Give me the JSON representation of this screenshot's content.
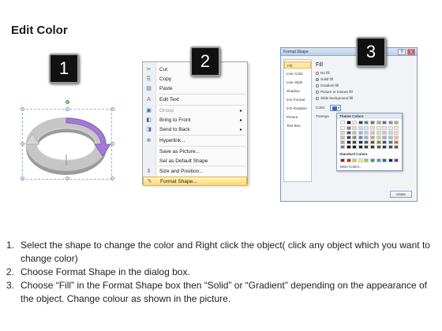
{
  "page": {
    "title": "Edit Color"
  },
  "badges": [
    "1",
    "2",
    "3"
  ],
  "context_menu": {
    "items": [
      {
        "label": "Cut",
        "icon": "scissors-icon",
        "glyph": "✂",
        "disabled": false,
        "submenu": false,
        "highlighted": false
      },
      {
        "label": "Copy",
        "icon": "copy-icon",
        "glyph": "⎘",
        "disabled": false,
        "submenu": false,
        "highlighted": false
      },
      {
        "label": "Paste",
        "icon": "paste-icon",
        "glyph": "▤",
        "disabled": false,
        "submenu": false,
        "highlighted": false
      },
      {
        "label": "Edit Text",
        "icon": "edit-text-icon",
        "glyph": "A",
        "disabled": false,
        "submenu": false,
        "highlighted": false
      },
      {
        "label": "Group",
        "icon": "group-icon",
        "glyph": "▣",
        "disabled": true,
        "submenu": true,
        "highlighted": false
      },
      {
        "label": "Bring to Front",
        "icon": "bring-front-icon",
        "glyph": "◧",
        "disabled": false,
        "submenu": true,
        "highlighted": false
      },
      {
        "label": "Send to Back",
        "icon": "send-back-icon",
        "glyph": "◨",
        "disabled": false,
        "submenu": true,
        "highlighted": false
      },
      {
        "label": "Hyperlink...",
        "icon": "hyperlink-icon",
        "glyph": "⊕",
        "disabled": false,
        "submenu": false,
        "highlighted": false
      },
      {
        "label": "Save as Picture...",
        "icon": "",
        "glyph": "",
        "disabled": false,
        "submenu": false,
        "highlighted": false
      },
      {
        "label": "Set as Default Shape",
        "icon": "",
        "glyph": "",
        "disabled": false,
        "submenu": false,
        "highlighted": false
      },
      {
        "label": "Size and Position...",
        "icon": "size-position-icon",
        "glyph": "⇕",
        "disabled": false,
        "submenu": false,
        "highlighted": false
      },
      {
        "label": "Format Shape...",
        "icon": "format-shape-icon",
        "glyph": "✎",
        "disabled": false,
        "submenu": false,
        "highlighted": true
      }
    ]
  },
  "format_dialog": {
    "title": "Format Shape",
    "help_label": "?",
    "close_x": "X",
    "nav": [
      "Fill",
      "Line Color",
      "Line Style",
      "Shadow",
      "3-D Format",
      "3-D Rotation",
      "Picture",
      "Text Box"
    ],
    "selected_nav": 0,
    "section_title": "Fill",
    "options": [
      {
        "label": "No fill",
        "selected": false
      },
      {
        "label": "Solid fill",
        "selected": true
      },
      {
        "label": "Gradient fill",
        "selected": false
      },
      {
        "label": "Picture or texture fill",
        "selected": false
      },
      {
        "label": "Slide background fill",
        "selected": false
      }
    ],
    "color_label": "Color:",
    "transparency_label": "Transpa",
    "theme_colors_label": "Theme Colors",
    "standard_colors_label": "Standard Colors",
    "more_colors_label": "More Colors...",
    "close_button": "Close",
    "theme_top_row": [
      "#ffffff",
      "#000000",
      "#eeece1",
      "#1f497d",
      "#4f81bd",
      "#c0504d",
      "#9bbb59",
      "#8064a2",
      "#4bacc6",
      "#f79646"
    ],
    "theme_shade_rows": [
      [
        "#f2f2f2",
        "#7f7f7f",
        "#ddd9c3",
        "#c6d9f0",
        "#dbe5f1",
        "#f2dcdb",
        "#ebf1dd",
        "#e5e0ec",
        "#dbeef3",
        "#fdeada"
      ],
      [
        "#d8d8d8",
        "#595959",
        "#c4bd97",
        "#8db3e2",
        "#b8cce4",
        "#e5b9b7",
        "#d7e3bc",
        "#ccc1d9",
        "#b7dde8",
        "#fbd5b5"
      ],
      [
        "#bfbfbf",
        "#3f3f3f",
        "#938953",
        "#548dd4",
        "#95b3d7",
        "#d99694",
        "#c3d69b",
        "#b2a2c7",
        "#92cddc",
        "#fac08f"
      ],
      [
        "#a5a5a5",
        "#262626",
        "#494429",
        "#17365d",
        "#366092",
        "#953734",
        "#76923c",
        "#5f497a",
        "#31859b",
        "#e36c09"
      ],
      [
        "#7f7f7f",
        "#0c0c0c",
        "#1d1b10",
        "#0f243e",
        "#244061",
        "#632423",
        "#4f6128",
        "#3f3151",
        "#205867",
        "#974806"
      ]
    ],
    "standard_colors": [
      "#c00000",
      "#ff0000",
      "#ffc000",
      "#ffff00",
      "#92d050",
      "#00b050",
      "#00b0f0",
      "#0070c0",
      "#002060",
      "#7030a0"
    ]
  },
  "shape": {
    "ring_color": "#b9b9b9",
    "ring_dark": "#8e8e8e",
    "highlight_color": "#a37ad6",
    "highlight_dark": "#7d52b8"
  },
  "instructions": [
    {
      "num": "1.",
      "text": "Select the shape to change the color and Right click the object( click any object which you want to change color)"
    },
    {
      "num": "2.",
      "text": "Choose Format Shape in the dialog box."
    },
    {
      "num": "3.",
      "text": "Choose “Fill” in the Format Shape box then “Solid” or “Gradient” depending on the appearance of the object. Change colour as shown in the picture."
    }
  ]
}
